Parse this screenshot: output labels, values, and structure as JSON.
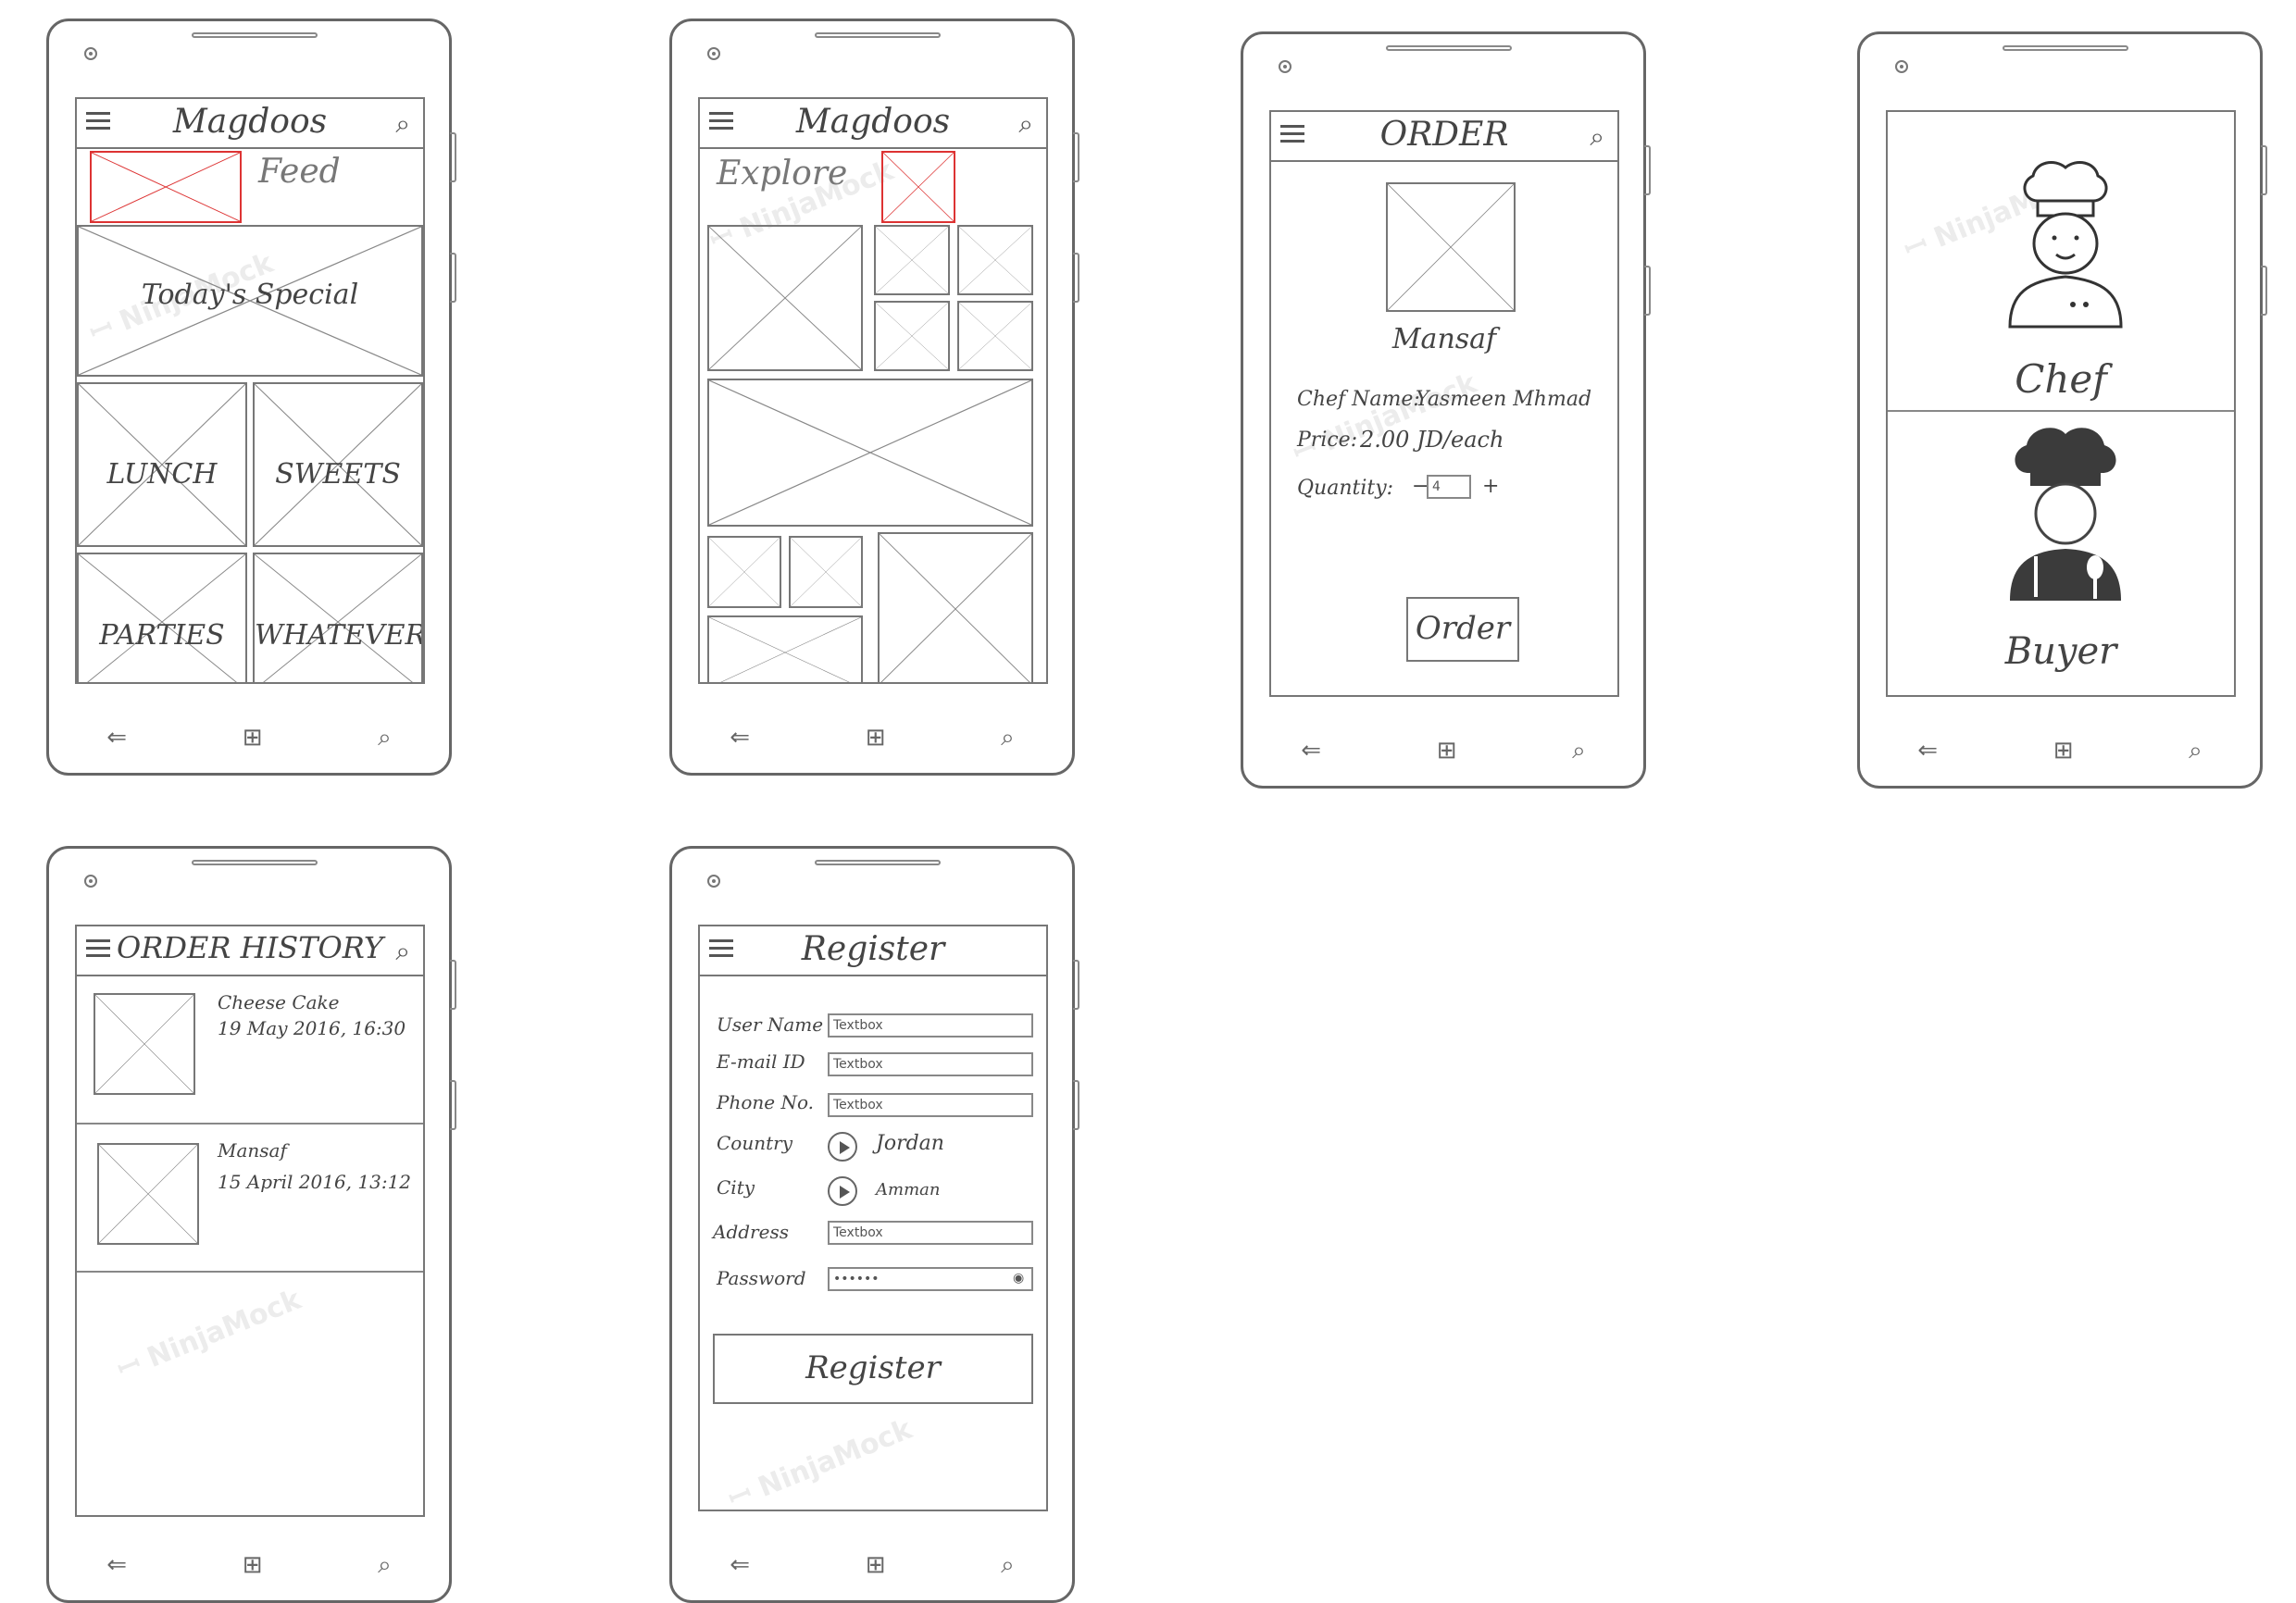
{
  "watermark": "NinjaMock",
  "nav_icons": {
    "back": "back-arrow-icon",
    "home": "windows-logo-icon",
    "search": "search-icon"
  },
  "feed": {
    "title": "Magdoos",
    "section": "Feed",
    "special": "Today's Special",
    "tiles": [
      "LUNCH",
      "SWEETS",
      "PARTIES",
      "WHATEVER"
    ]
  },
  "explore": {
    "title": "Magdoos",
    "section": "Explore"
  },
  "order": {
    "title": "ORDER",
    "item": "Mansaf",
    "chef_label": "Chef Name:",
    "chef_value": "Yasmeen Mhmad",
    "price_label": "Price:",
    "price_value": "2.00 JD/each",
    "quantity_label": "Quantity:",
    "quantity_minus": "−",
    "quantity_value": "4",
    "quantity_plus": "+",
    "button": "Order"
  },
  "role": {
    "chef_label": "Chef",
    "buyer_label": "Buyer"
  },
  "history": {
    "title": "ORDER HISTORY",
    "items": [
      {
        "name": "Cheese Cake",
        "date": "19 May 2016, 16:30"
      },
      {
        "name": "Mansaf",
        "date": "15 April 2016, 13:12"
      }
    ]
  },
  "register": {
    "title": "Register",
    "fields": [
      {
        "label": "User Name",
        "placeholder": "Textbox"
      },
      {
        "label": "E-mail ID",
        "placeholder": "Textbox"
      },
      {
        "label": "Phone No.",
        "placeholder": "Textbox"
      }
    ],
    "country_label": "Country",
    "country_value": "Jordan",
    "city_label": "City",
    "city_value": "Amman",
    "address_label": "Address",
    "address_placeholder": "Textbox",
    "password_label": "Password",
    "password_value": "••••••",
    "button": "Register"
  }
}
